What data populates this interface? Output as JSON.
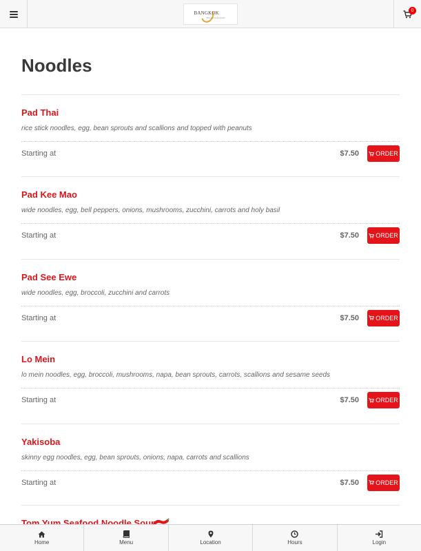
{
  "header": {
    "logo_text": "BANGKOK",
    "logo_subtext": "THAI RESTAURANT",
    "cart_count": "0"
  },
  "page_title": "Noodles",
  "items": [
    {
      "name": "Pad Thai",
      "description": "rice stick noodles, egg, bean sprouts and scallions and topped with peanuts",
      "starting_label": "Starting at",
      "price": "$7.50",
      "order_label": "ORDER"
    },
    {
      "name": "Pad Kee Mao",
      "description": "wide noodles, egg, bell peppers, onions, mushrooms, zucchini, carrots and holy basil",
      "starting_label": "Starting at",
      "price": "$7.50",
      "order_label": "ORDER"
    },
    {
      "name": "Pad See Ewe",
      "description": "wide noodles, egg, broccoli, zucchini and carrots",
      "starting_label": "Starting at",
      "price": "$7.50",
      "order_label": "ORDER"
    },
    {
      "name": "Lo Mein",
      "description": "lo mein noodles, egg, broccoli, mushrooms, napa, bean sprouts, carrots, scallions and sesame seeds",
      "starting_label": "Starting at",
      "price": "$7.50",
      "order_label": "ORDER"
    },
    {
      "name": "Yakisoba",
      "description": "skinny egg noodles, egg, bean sprouts, onions, napa, carrots and scallions",
      "starting_label": "Starting at",
      "price": "$7.50",
      "order_label": "ORDER"
    }
  ],
  "partial_item": {
    "name": "Tom Yum Seafood Noodle Soup"
  },
  "bottom_nav": [
    {
      "label": "Home",
      "icon": "home-icon"
    },
    {
      "label": "Menu",
      "icon": "book-icon"
    },
    {
      "label": "Location",
      "icon": "map-marker-icon"
    },
    {
      "label": "Hours",
      "icon": "clock-icon"
    },
    {
      "label": "Login",
      "icon": "sign-in-icon"
    }
  ],
  "colors": {
    "accent": "#e5141a",
    "item_name": "#d8161b"
  }
}
